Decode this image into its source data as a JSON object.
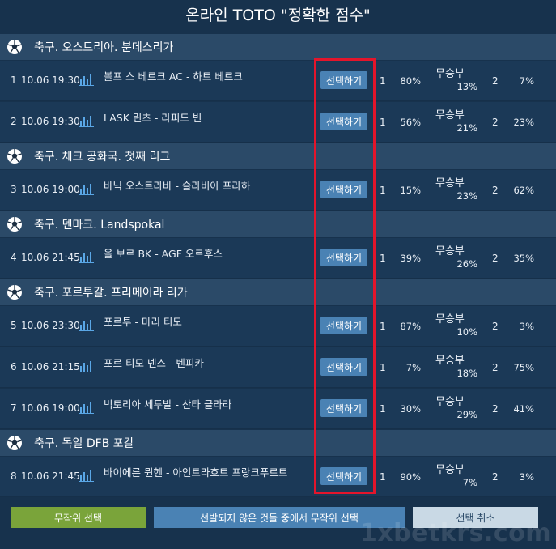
{
  "title": "온라인 TOTO \"정확한 점수\"",
  "draw_label": "무승부",
  "col1_label": "1",
  "col2_label": "2",
  "leagues": [
    {
      "name": "축구. 오스트리아. 분데스리가"
    },
    {
      "name": "축구. 체크 공화국. 첫째 리그"
    },
    {
      "name": "축구. 덴마크. Landspokal"
    },
    {
      "name": "축구. 포르투갈. 프리메이라 리가"
    },
    {
      "name": "축구. 독일 DFB 포칼"
    }
  ],
  "matches": [
    {
      "num": "1",
      "time": "10.06 19:30",
      "teams": "볼프 스 베르크 AC - 하트 베르크",
      "pick_label": "선택하기",
      "p1": "80%",
      "pd": "13%",
      "p2": "7%"
    },
    {
      "num": "2",
      "time": "10.06 19:30",
      "teams": "LASK 린츠 - 라피드 빈",
      "pick_label": "선택하기",
      "p1": "56%",
      "pd": "21%",
      "p2": "23%"
    },
    {
      "num": "3",
      "time": "10.06 19:00",
      "teams": "바닉 오스트라바 - 슬라비아 프라하",
      "pick_label": "선택하기",
      "p1": "15%",
      "pd": "23%",
      "p2": "62%"
    },
    {
      "num": "4",
      "time": "10.06 21:45",
      "teams": "올 보르 BK - AGF 오르후스",
      "pick_label": "선택하기",
      "p1": "39%",
      "pd": "26%",
      "p2": "35%"
    },
    {
      "num": "5",
      "time": "10.06 23:30",
      "teams": "포르투 - 마리 티모",
      "pick_label": "선택하기",
      "p1": "87%",
      "pd": "10%",
      "p2": "3%"
    },
    {
      "num": "6",
      "time": "10.06 21:15",
      "teams": "포르 티모 넨스 - 벤피카",
      "pick_label": "선택하기",
      "p1": "7%",
      "pd": "18%",
      "p2": "75%"
    },
    {
      "num": "7",
      "time": "10.06 19:00",
      "teams": "빅토리아 세투발 - 산타 클라라",
      "pick_label": "선택하기",
      "p1": "30%",
      "pd": "29%",
      "p2": "41%"
    },
    {
      "num": "8",
      "time": "10.06 21:45",
      "teams": "바이에른 뮌헨 - 아인트라흐트 프랑크푸르트",
      "pick_label": "선택하기",
      "p1": "90%",
      "pd": "7%",
      "p2": "3%"
    }
  ],
  "buttons": {
    "random": "무작위 선택",
    "random_unselected": "선발되지 않은 것들 중에서 무작위 선택",
    "cancel": "선택 취소"
  },
  "watermark": "1xbetkrs.com",
  "colors": {
    "background": "#17324d",
    "league_header": "#2b4a68",
    "pick_button": "#4a82b4",
    "random_button": "#7aa43a",
    "cancel_button": "#c9d9e5",
    "highlight_box": "#e4152b"
  }
}
